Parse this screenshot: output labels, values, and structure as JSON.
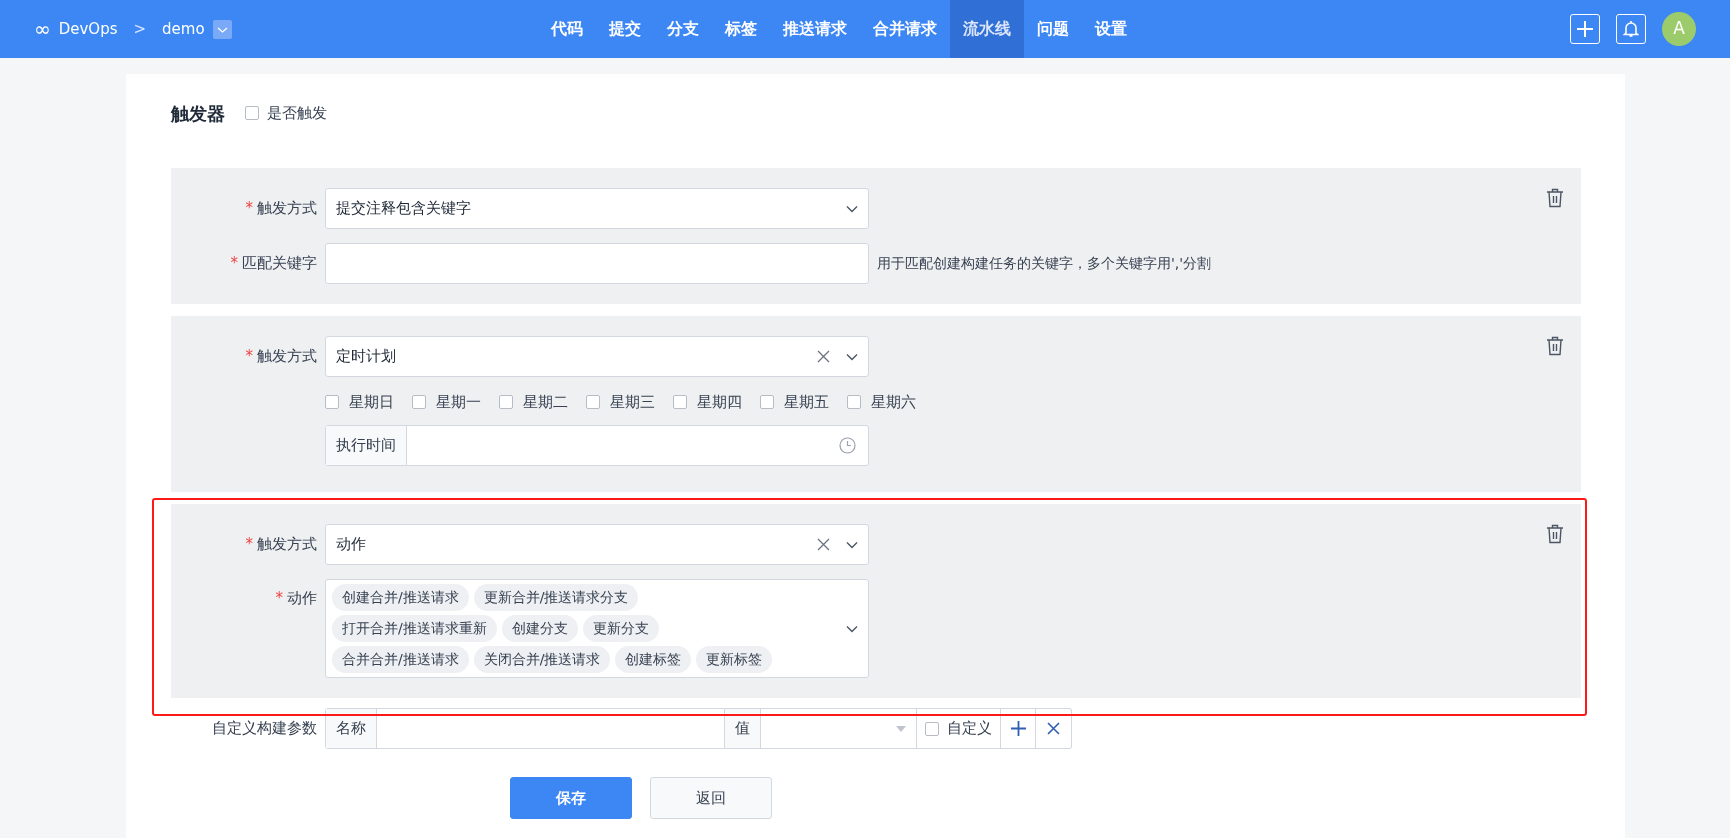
{
  "header": {
    "logo": "∞",
    "brand": "DevOps",
    "separator": ">",
    "repo": "demo",
    "nav": [
      {
        "label": "代码",
        "selected": false
      },
      {
        "label": "提交",
        "selected": false
      },
      {
        "label": "分支",
        "selected": false
      },
      {
        "label": "标签",
        "selected": false
      },
      {
        "label": "推送请求",
        "selected": false
      },
      {
        "label": "合并请求",
        "selected": false
      },
      {
        "label": "流水线",
        "selected": true
      },
      {
        "label": "问题",
        "selected": false
      },
      {
        "label": "设置",
        "selected": false
      }
    ],
    "avatar": "A"
  },
  "form": {
    "title": "触发器",
    "enabled": {
      "label": "是否触发",
      "checked": false
    },
    "triggers": [
      {
        "kind": "keyword",
        "highlighted": false,
        "method": {
          "mark": "*",
          "label": "触发方式",
          "value": "提交注释包含关键字",
          "clearable": false
        },
        "keyword": {
          "mark": "*",
          "label": "匹配关键字",
          "hint": "用于匹配创建构建任务的关键字，多个关键字用','分割"
        }
      },
      {
        "kind": "schedule",
        "highlighted": false,
        "method": {
          "mark": "*",
          "label": "触发方式",
          "value": "定时计划",
          "clearable": true
        },
        "days": [
          {
            "label": "星期日",
            "checked": false
          },
          {
            "label": "星期一",
            "checked": false
          },
          {
            "label": "星期二",
            "checked": false
          },
          {
            "label": "星期三",
            "checked": false
          },
          {
            "label": "星期四",
            "checked": false
          },
          {
            "label": "星期五",
            "checked": false
          },
          {
            "label": "星期六",
            "checked": false
          }
        ],
        "time": {
          "addon": "执行时间"
        }
      },
      {
        "kind": "action",
        "highlighted": true,
        "method": {
          "mark": "*",
          "label": "触发方式",
          "value": "动作",
          "clearable": true
        },
        "actions": {
          "mark": "*",
          "label": "动作",
          "tags": [
            [
              "创建合并/推送请求",
              "更新合并/推送请求分支"
            ],
            [
              "打开合并/推送请求重新",
              "创建分支",
              "更新分支"
            ],
            [
              "合并合并/推送请求",
              "关闭合并/推送请求",
              "创建标签",
              "更新标签"
            ]
          ]
        }
      }
    ],
    "custom_params": {
      "label": "自定义构建参数",
      "name_addon": "名称",
      "value_addon": "值",
      "custom": {
        "label": "自定义",
        "checked": false
      }
    },
    "buttons": [
      {
        "label": "保存",
        "kind": "primary"
      },
      {
        "label": "返回",
        "kind": "default"
      }
    ]
  }
}
